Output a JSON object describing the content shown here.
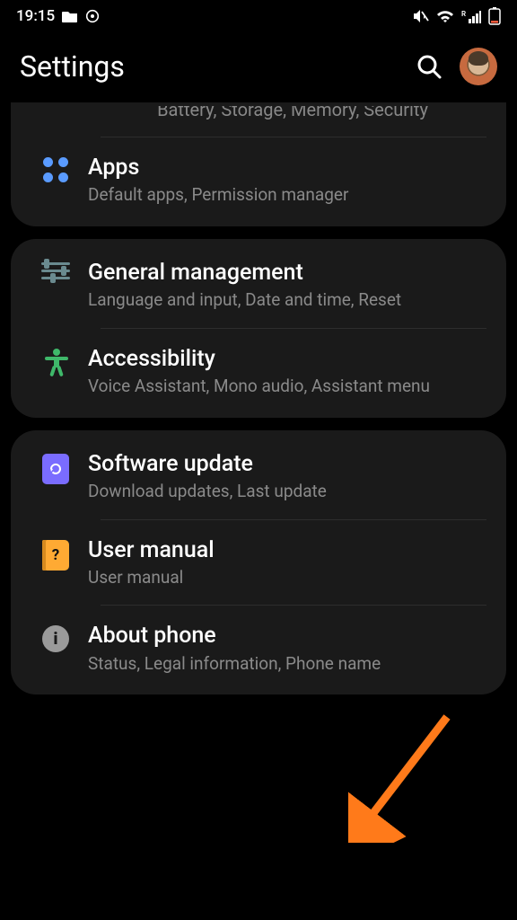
{
  "status": {
    "time": "19:15"
  },
  "header": {
    "title": "Settings"
  },
  "partial_sub": "Battery, Storage, Memory, Security",
  "groups": [
    {
      "items": [
        {
          "title": "Apps",
          "sub": "Default apps, Permission manager",
          "icon": "apps"
        }
      ]
    },
    {
      "items": [
        {
          "title": "General management",
          "sub": "Language and input, Date and time, Reset",
          "icon": "sliders"
        },
        {
          "title": "Accessibility",
          "sub": "Voice Assistant, Mono audio, Assistant menu",
          "icon": "access"
        }
      ]
    },
    {
      "items": [
        {
          "title": "Software update",
          "sub": "Download updates, Last update",
          "icon": "update"
        },
        {
          "title": "User manual",
          "sub": "User manual",
          "icon": "manual"
        },
        {
          "title": "About phone",
          "sub": "Status, Legal information, Phone name",
          "icon": "info"
        }
      ]
    }
  ]
}
